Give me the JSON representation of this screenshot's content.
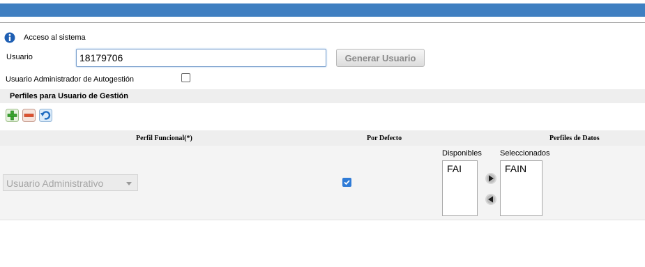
{
  "header": {
    "section_title": "Acceso al sistema"
  },
  "form": {
    "usuario_label": "Usuario",
    "usuario_value": "18179706",
    "generate_button": "Generar Usuario",
    "admin_autogestion_label": "Usuario Administrador de Autogestión",
    "admin_autogestion_checked": false
  },
  "profiles": {
    "section_title": "Perfiles para Usuario de Gestión",
    "toolbar": {
      "add_icon": "add-icon",
      "remove_icon": "remove-icon",
      "undo_icon": "undo-icon"
    },
    "columns": [
      "Perfil Funcional(*)",
      "Por Defecto",
      "Perfiles de Datos"
    ],
    "row": {
      "perfil_funcional": "Usuario Administrativo",
      "por_defecto_checked": true,
      "disponibles_label": "Disponibles",
      "seleccionados_label": "Seleccionados",
      "disponibles": [
        "FAI"
      ],
      "seleccionados": [
        "FAIN"
      ]
    }
  },
  "colors": {
    "topbar": "#3f7fc1",
    "checkbox_checked": "#2f7bd6"
  }
}
